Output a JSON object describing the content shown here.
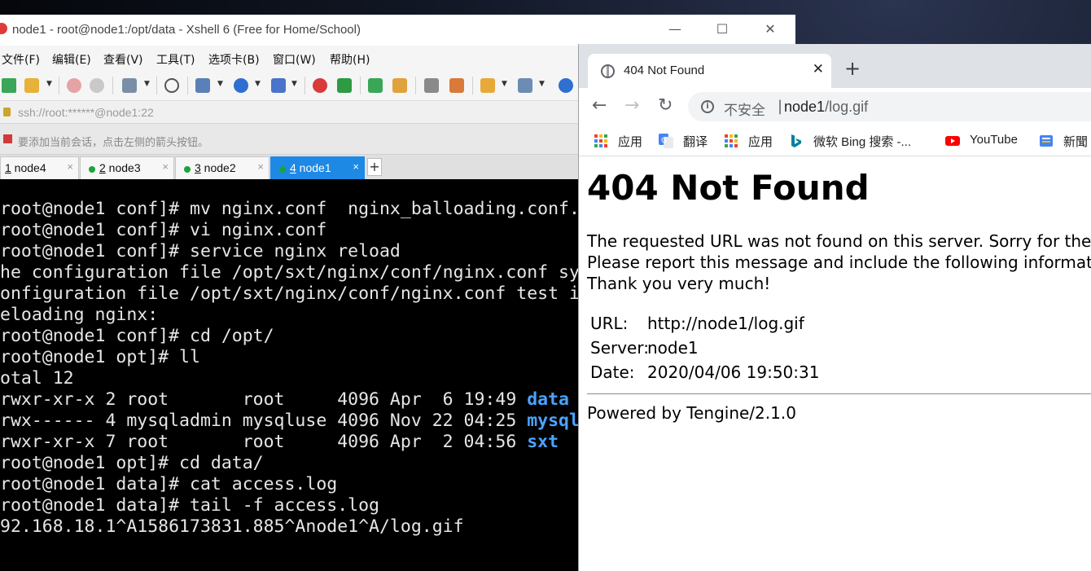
{
  "xshell": {
    "title": "node1 - root@node1:/opt/data - Xshell 6 (Free for Home/School)",
    "controls": {
      "minimize": "—",
      "maximize": "☐",
      "close": "✕"
    },
    "menu": [
      "文件(F)",
      "编辑(E)",
      "查看(V)",
      "工具(T)",
      "选项卡(B)",
      "窗口(W)",
      "帮助(H)"
    ],
    "address": "ssh://root:******@node1:22",
    "hint": "要添加当前会话，点击左侧的箭头按钮。",
    "tabs": [
      {
        "num": "1",
        "name": " node4",
        "close": "×",
        "connected": false,
        "active": false
      },
      {
        "num": "2",
        "name": " node3",
        "close": "×",
        "connected": true,
        "active": false
      },
      {
        "num": "3",
        "name": " node2",
        "close": "×",
        "connected": true,
        "active": false
      },
      {
        "num": "4",
        "name": " node1",
        "close": "×",
        "connected": true,
        "active": true
      }
    ],
    "new_tab": "+",
    "terminal": {
      "lines": [
        {
          "text": "root@node1 conf]# mv nginx.conf  nginx_balloading.conf."
        },
        {
          "text": "root@node1 conf]# vi nginx.conf"
        },
        {
          "text": "root@node1 conf]# service nginx reload"
        },
        {
          "text": "he configuration file /opt/sxt/nginx/conf/nginx.conf sy"
        },
        {
          "text": "onfiguration file /opt/sxt/nginx/conf/nginx.conf test i"
        },
        {
          "text": "eloading nginx:"
        },
        {
          "text": "root@node1 conf]# cd /opt/"
        },
        {
          "text": "root@node1 opt]# ll"
        },
        {
          "text": "otal 12"
        },
        {
          "text": "rwxr-xr-x 2 root       root     4096 Apr  6 19:49 ",
          "hl": "data"
        },
        {
          "text": "rwx------ 4 mysqladmin mysqluse 4096 Nov 22 04:25 ",
          "hl": "mysql"
        },
        {
          "text": "rwxr-xr-x 7 root       root     4096 Apr  2 04:56 ",
          "hl": "sxt"
        },
        {
          "text": "root@node1 opt]# cd data/"
        },
        {
          "text": "root@node1 data]# cat access.log"
        },
        {
          "text": "root@node1 data]# tail -f access.log"
        },
        {
          "text": "92.168.18.1^A1586173831.885^Anode1^A/log.gif"
        }
      ]
    }
  },
  "chrome": {
    "tab_title": "404 Not Found",
    "tab_close": "✕",
    "new_tab": "+",
    "nav": {
      "back": "←",
      "forward": "→",
      "reload": "↻"
    },
    "omnibox": {
      "security": "不安全",
      "separator": "|",
      "host": "node1",
      "path": "/log.gif",
      "info_glyph": "i"
    },
    "bookmarks": [
      {
        "label": "应用",
        "icon": "apps-icon",
        "color": "#ea4335"
      },
      {
        "label": "翻译",
        "icon": "google-translate-icon",
        "color": "#4285f4"
      },
      {
        "label": "应用",
        "icon": "apps-icon",
        "color": "#ea4335"
      },
      {
        "label": "微软 Bing 搜索 -...",
        "icon": "bing-icon",
        "color": "#00809d"
      },
      {
        "label": "YouTube",
        "icon": "youtube-icon",
        "color": "#ff0000"
      },
      {
        "label": "新聞",
        "icon": "news-icon",
        "color": "#4285f4"
      }
    ],
    "page": {
      "heading": "404 Not Found",
      "para1": "The requested URL was not found on this server. Sorry for the inc",
      "para2": "Please report this message and include the following informatio",
      "para3": "Thank you very much!",
      "rows": [
        {
          "key": "URL:",
          "value": "http://node1/log.gif"
        },
        {
          "key": "Server:",
          "value": "node1"
        },
        {
          "key": "Date:",
          "value": "2020/04/06 19:50:31"
        }
      ],
      "footer": "Powered by Tengine/2.1.0"
    }
  },
  "colors": {
    "terminal_bg": "#000000",
    "terminal_fg": "#e6e6e6",
    "terminal_dir": "#4aa3ff",
    "xshell_active_tab": "#1e88e5",
    "chrome_tabstrip": "#dee1e6"
  }
}
